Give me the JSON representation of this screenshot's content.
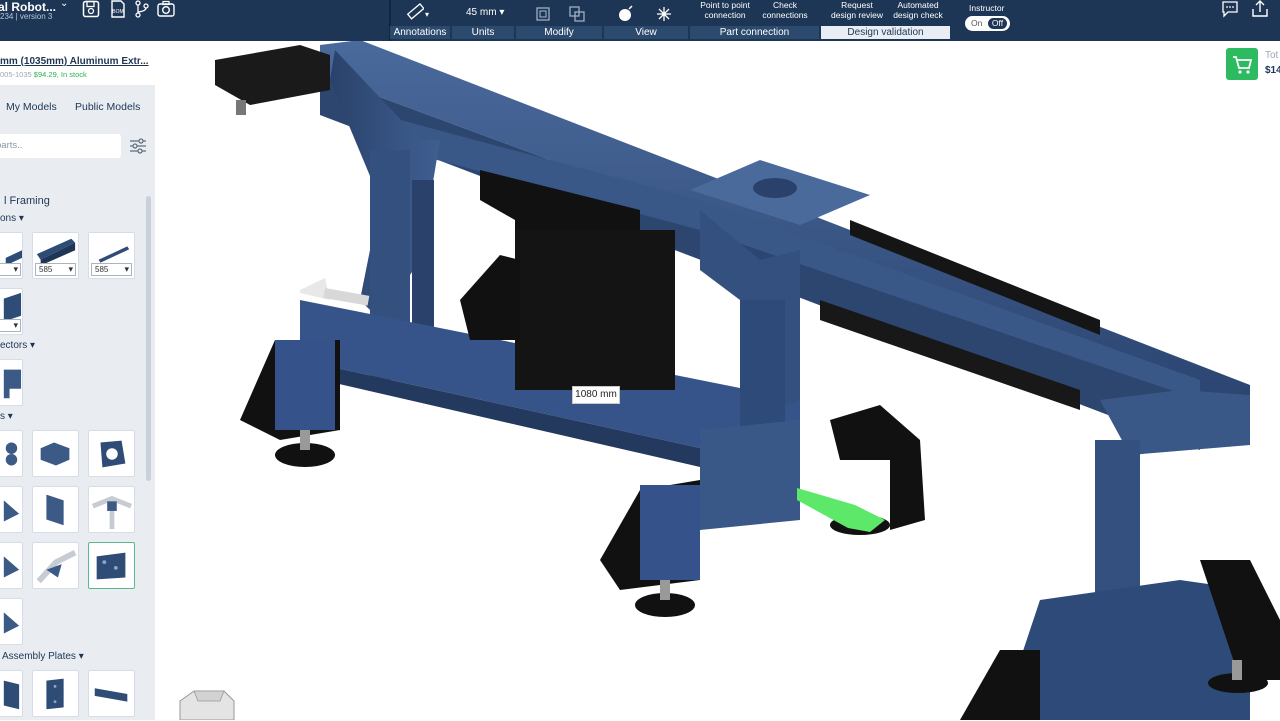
{
  "project": {
    "title": "al Robot...",
    "subtitle": "234 | version 3"
  },
  "toolbar": {
    "groups": [
      {
        "label": "Annotations"
      },
      {
        "label": "Units"
      },
      {
        "label": "Modify"
      },
      {
        "label": "View"
      },
      {
        "label": "Part connection"
      },
      {
        "label": "Design validation"
      }
    ],
    "units_value": "45 mm",
    "point_to_point": "Point to point\nconnection",
    "check_connections": "Check\nconnections",
    "request_review": "Request\ndesign review",
    "automated_check": "Automated\ndesign check",
    "instructor_label": "Instructor",
    "toggle_on": "On",
    "toggle_off": "Off"
  },
  "sidebar": {
    "product_name": "mm (1035mm) Aluminum Extr...",
    "product_sku": "005-1035",
    "product_price_stock": "$94.29, In stock",
    "tabs": [
      "My Models",
      "Public Models"
    ],
    "search_placeholder": "parts..",
    "section_title": "l Framing",
    "subsections": [
      "ons",
      "ectors",
      "s",
      "Assembly Plates"
    ],
    "extrusion_lengths": [
      "",
      "585",
      "585",
      ""
    ]
  },
  "viewport": {
    "dimension_label": "1080 mm"
  },
  "cart": {
    "total_label": "Tot",
    "total_value": "$14"
  },
  "colors": {
    "toolbar_bg": "#1d3655",
    "frame_blue": "#33507f",
    "accent_green": "#2dbb62",
    "highlight_green": "#5ee86a"
  }
}
